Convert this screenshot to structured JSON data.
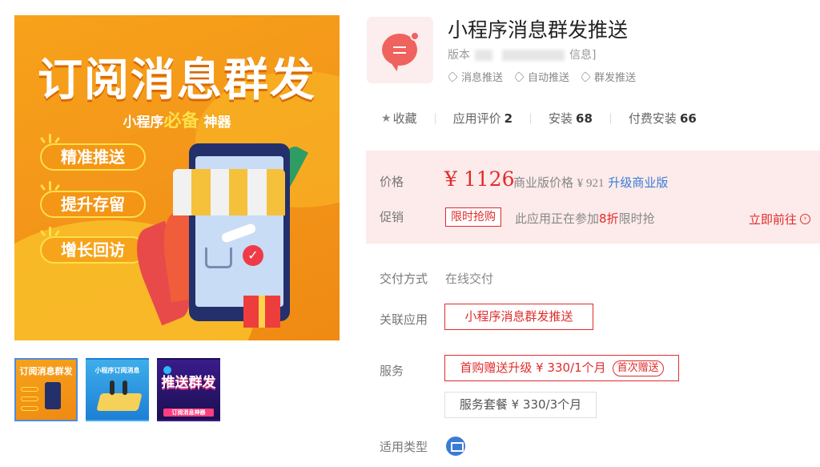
{
  "gallery": {
    "main_image": {
      "headline": "订阅消息群发",
      "subline_prefix": "小程序",
      "subline_highlight": "必备",
      "subline_suffix": "神器",
      "features": [
        "精准推送",
        "提升存留",
        "增长回访"
      ]
    },
    "thumbnails": [
      {
        "text": "订阅消息群发",
        "selected": true
      },
      {
        "text": "小程序订阅消息",
        "selected": false
      },
      {
        "text_big": "推送群发",
        "text_small": "订阅消息神器",
        "selected": false
      }
    ]
  },
  "app": {
    "icon": "chat-bubble-icon",
    "title": "小程序消息群发推送",
    "version_prefix": "版本",
    "version_suffix": "信息]",
    "tags": [
      "消息推送",
      "自动推送",
      "群发推送"
    ]
  },
  "stats": {
    "favorite_label": "收藏",
    "rating_label": "应用评价",
    "rating_count": "2",
    "install_label": "安装",
    "install_count": "68",
    "paid_install_label": "付费安装",
    "paid_install_count": "66"
  },
  "pricing": {
    "price_label": "价格",
    "price": "¥ 1126",
    "biz_label": "商业版价格",
    "biz_price": "¥ 921",
    "upgrade_link": "升级商业版",
    "promo_label": "促销",
    "promo_tag": "限时抢购",
    "promo_text_prefix": "此应用正在参加",
    "promo_discount": "8折",
    "promo_text_suffix": "限时抢",
    "goto_label": "立即前往",
    "accent_color": "#e12b2b"
  },
  "details": {
    "delivery_label": "交付方式",
    "delivery_value": "在线交付",
    "related_label": "关联应用",
    "related_app": "小程序消息群发推送",
    "service_label": "服务",
    "service_options": [
      {
        "label": "首购赠送升级 ¥ 330/1个月",
        "badge": "首次赠送",
        "selected": true
      },
      {
        "label": "服务套餐 ¥ 330/3个月",
        "selected": false
      }
    ],
    "type_label": "适用类型",
    "type_icon": "desktop-icon"
  }
}
